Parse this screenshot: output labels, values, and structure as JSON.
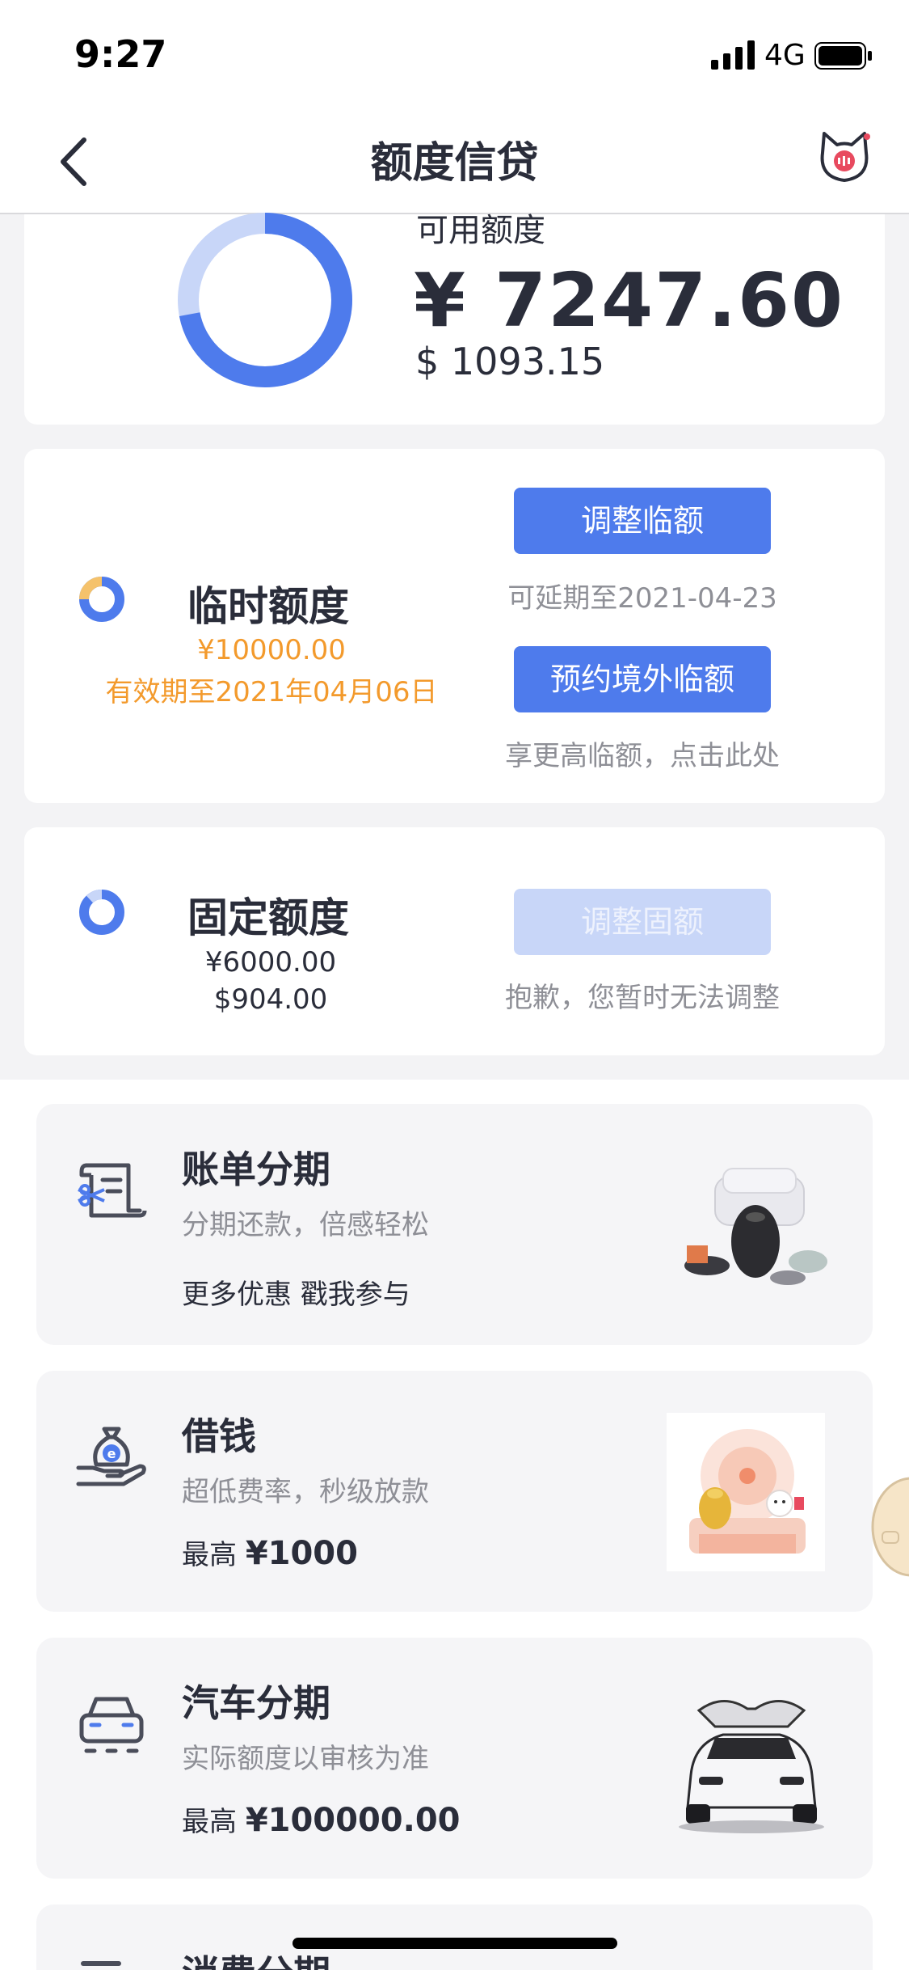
{
  "status_bar": {
    "time": "9:27",
    "network": "4G"
  },
  "nav": {
    "title": "额度信贷",
    "back_icon": "chevron-left-icon",
    "mascot_icon": "cat-mascot-icon"
  },
  "available": {
    "label": "可用额度",
    "amount_cny": "¥ 7247.60",
    "amount_usd": "$ 1093.15",
    "ring": {
      "used_fraction": 0.28,
      "color_main": "#4e7bec",
      "color_track": "#c8d6f8"
    }
  },
  "temporary": {
    "title": "临时额度",
    "amount": "¥10000.00",
    "validity": "有效期至2021年04月06日",
    "btn_adjust": "调整临额",
    "adjust_hint": "可延期至2021-04-23",
    "btn_overseas": "预约境外临额",
    "overseas_hint": "享更高临额，点击此处",
    "accent_color": "#f39a2c"
  },
  "fixed": {
    "title": "固定额度",
    "amount_cny": "¥6000.00",
    "amount_usd": "$904.00",
    "btn_adjust": "调整固额",
    "adjust_hint": "抱歉，您暂时无法调整"
  },
  "products": [
    {
      "title": "账单分期",
      "subtitle": "分期还款，倍感轻松",
      "extra_prefix": "更多优惠 戳我参与",
      "extra_value": "",
      "icon": "bill-installment-icon",
      "image": "home-goods-image"
    },
    {
      "title": "借钱",
      "subtitle": "超低费率，秒级放款",
      "extra_prefix": "最高",
      "extra_value": "¥1000",
      "icon": "money-bag-hand-icon",
      "image": "gold-safe-promo-image"
    },
    {
      "title": "汽车分期",
      "subtitle": "实际额度以审核为准",
      "extra_prefix": "最高",
      "extra_value": "¥100000.00",
      "icon": "car-icon",
      "image": "white-car-image"
    },
    {
      "title": "消费分期"
    }
  ],
  "colors": {
    "brand_blue": "#4e7bec",
    "text_dark": "#2a2d3a",
    "text_grey": "#8e8f96",
    "orange": "#f39a2c"
  }
}
